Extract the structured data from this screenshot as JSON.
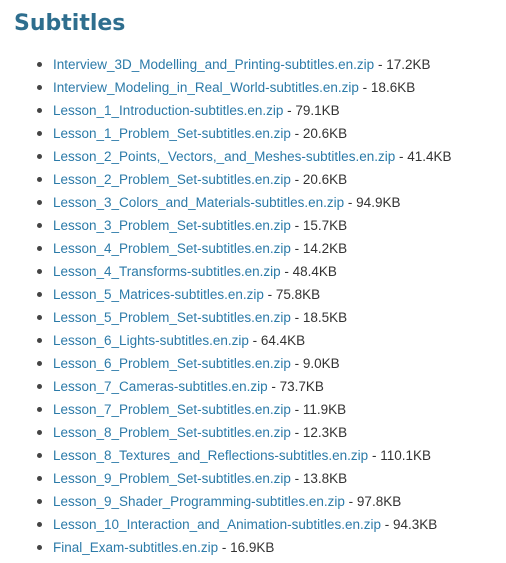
{
  "page": {
    "title": "Subtitles"
  },
  "colors": {
    "title": "#2e6e8e",
    "link": "#2b7aa8",
    "text": "#333333"
  },
  "files": [
    {
      "name": "Interview_3D_Modelling_and_Printing-subtitles.en.zip",
      "size": "17.2KB"
    },
    {
      "name": "Interview_Modeling_in_Real_World-subtitles.en.zip",
      "size": "18.6KB"
    },
    {
      "name": "Lesson_1_Introduction-subtitles.en.zip",
      "size": "79.1KB"
    },
    {
      "name": "Lesson_1_Problem_Set-subtitles.en.zip",
      "size": "20.6KB"
    },
    {
      "name": "Lesson_2_Points,_Vectors,_and_Meshes-subtitles.en.zip",
      "size": "41.4KB"
    },
    {
      "name": "Lesson_2_Problem_Set-subtitles.en.zip",
      "size": "20.6KB"
    },
    {
      "name": "Lesson_3_Colors_and_Materials-subtitles.en.zip",
      "size": "94.9KB"
    },
    {
      "name": "Lesson_3_Problem_Set-subtitles.en.zip",
      "size": "15.7KB"
    },
    {
      "name": "Lesson_4_Problem_Set-subtitles.en.zip",
      "size": "14.2KB"
    },
    {
      "name": "Lesson_4_Transforms-subtitles.en.zip",
      "size": "48.4KB"
    },
    {
      "name": "Lesson_5_Matrices-subtitles.en.zip",
      "size": "75.8KB"
    },
    {
      "name": "Lesson_5_Problem_Set-subtitles.en.zip",
      "size": "18.5KB"
    },
    {
      "name": "Lesson_6_Lights-subtitles.en.zip",
      "size": "64.4KB"
    },
    {
      "name": "Lesson_6_Problem_Set-subtitles.en.zip",
      "size": "9.0KB"
    },
    {
      "name": "Lesson_7_Cameras-subtitles.en.zip",
      "size": "73.7KB"
    },
    {
      "name": "Lesson_7_Problem_Set-subtitles.en.zip",
      "size": "11.9KB"
    },
    {
      "name": "Lesson_8_Problem_Set-subtitles.en.zip",
      "size": "12.3KB"
    },
    {
      "name": "Lesson_8_Textures_and_Reflections-subtitles.en.zip",
      "size": "110.1KB"
    },
    {
      "name": "Lesson_9_Problem_Set-subtitles.en.zip",
      "size": "13.8KB"
    },
    {
      "name": "Lesson_9_Shader_Programming-subtitles.en.zip",
      "size": "97.8KB"
    },
    {
      "name": "Lesson_10_Interaction_and_Animation-subtitles.en.zip",
      "size": "94.3KB"
    },
    {
      "name": "Final_Exam-subtitles.en.zip",
      "size": "16.9KB"
    }
  ]
}
